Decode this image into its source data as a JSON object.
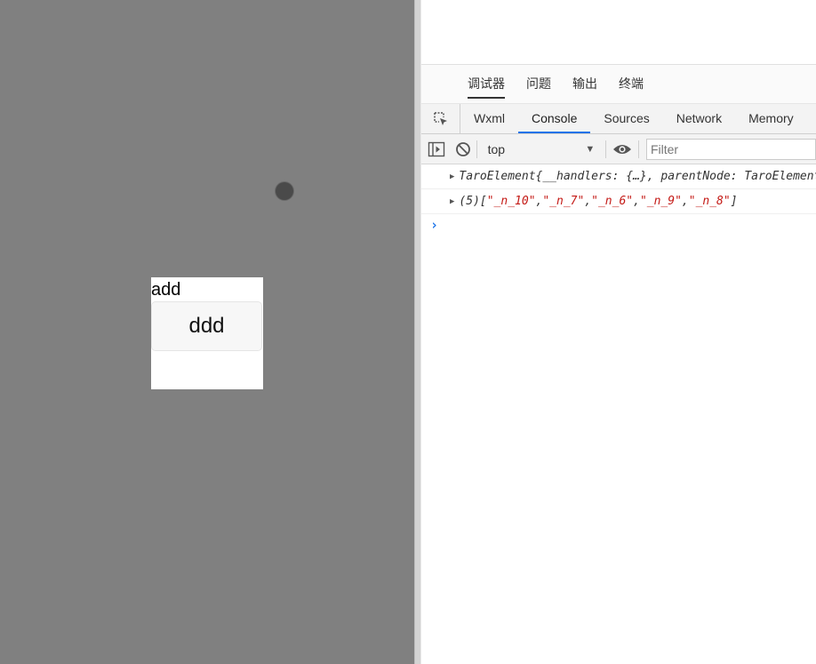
{
  "simulator": {
    "card_text": "add",
    "button_label": "ddd"
  },
  "devtools": {
    "cn_tabs": [
      "调试器",
      "问题",
      "输出",
      "终端"
    ],
    "panel_tabs": [
      "Wxml",
      "Console",
      "Sources",
      "Network",
      "Memory"
    ],
    "context": "top",
    "filter_placeholder": "Filter",
    "log": {
      "row1": {
        "object_name": "TaroElement",
        "body": " {__handlers: {…}, parentNode: TaroElement"
      },
      "row2": {
        "count": "(5) ",
        "open": "[",
        "items": [
          "\"_n_10\"",
          "\"_n_7\"",
          "\"_n_6\"",
          "\"_n_9\"",
          "\"_n_8\""
        ],
        "close": "]"
      }
    }
  },
  "colors": {
    "simulator_bg": "#808080",
    "active_tab_underline": "#1a73e8",
    "string_value": "#c41a16"
  }
}
